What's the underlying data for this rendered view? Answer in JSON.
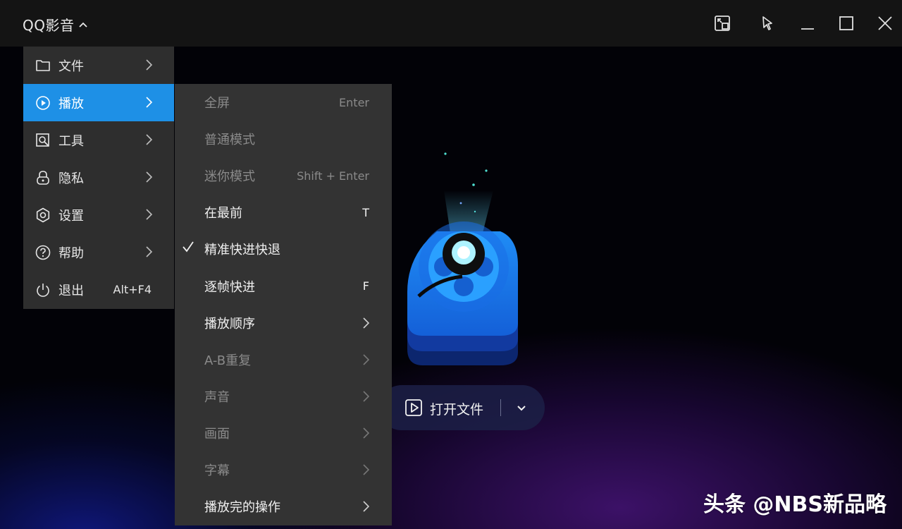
{
  "app": {
    "title": "QQ影音",
    "watermark": "头条 @NBS新品略"
  },
  "colors": {
    "accent": "#1e90e6",
    "menu_bg": "#2e2e2e",
    "submenu_bg": "#333333",
    "disabled_text": "#8a8a8a"
  },
  "main_menu": {
    "items": [
      {
        "label": "文件",
        "icon": "folder-icon",
        "has_submenu": true
      },
      {
        "label": "播放",
        "icon": "play-circle-icon",
        "has_submenu": true,
        "active": true
      },
      {
        "label": "工具",
        "icon": "tools-icon",
        "has_submenu": true
      },
      {
        "label": "隐私",
        "icon": "lock-icon",
        "has_submenu": true
      },
      {
        "label": "设置",
        "icon": "gear-icon",
        "has_submenu": true
      },
      {
        "label": "帮助",
        "icon": "help-icon",
        "has_submenu": true
      },
      {
        "label": "退出",
        "icon": "power-icon",
        "shortcut": "Alt+F4"
      }
    ]
  },
  "play_submenu": {
    "items": [
      {
        "label": "全屏",
        "shortcut": "Enter",
        "disabled": true
      },
      {
        "label": "普通模式",
        "shortcut": "",
        "disabled": true
      },
      {
        "label": "迷你模式",
        "shortcut": "Shift + Enter",
        "disabled": true
      },
      {
        "label": "在最前",
        "shortcut": "T",
        "disabled": false
      },
      {
        "label": "精准快进快退",
        "shortcut": "",
        "disabled": false,
        "checked": true
      },
      {
        "label": "逐帧快进",
        "shortcut": "F",
        "disabled": false
      },
      {
        "label": "播放顺序",
        "has_submenu": true,
        "disabled": false
      },
      {
        "label": "A-B重复",
        "has_submenu": true,
        "disabled": true
      },
      {
        "label": "声音",
        "has_submenu": true,
        "disabled": true
      },
      {
        "label": "画面",
        "has_submenu": true,
        "disabled": true
      },
      {
        "label": "字幕",
        "has_submenu": true,
        "disabled": true
      },
      {
        "label": "播放完的操作",
        "has_submenu": true,
        "disabled": false
      }
    ]
  },
  "open_button": {
    "label": "打开文件"
  }
}
